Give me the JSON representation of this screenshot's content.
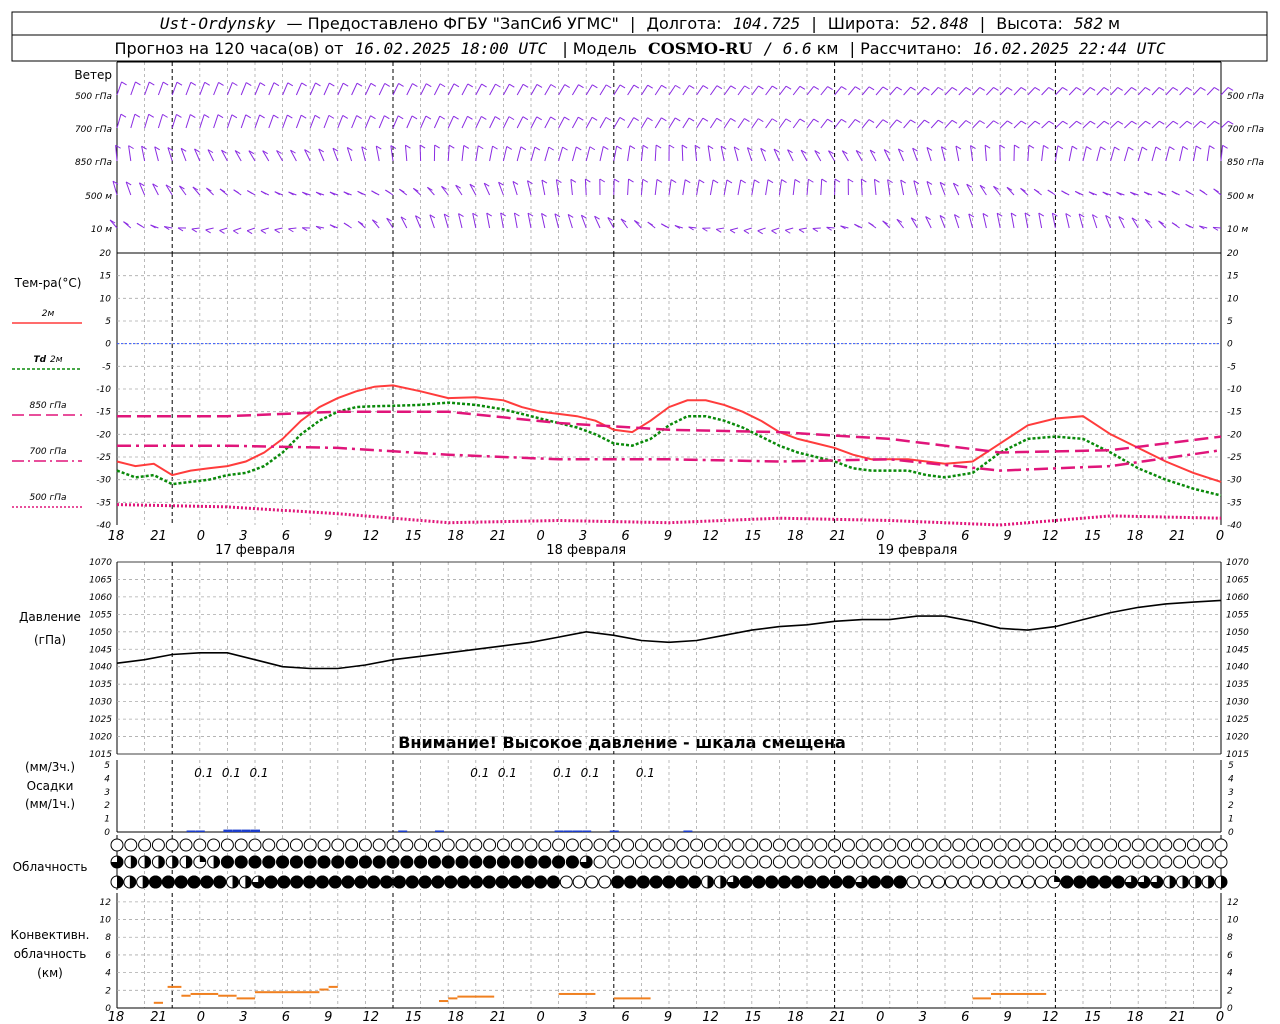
{
  "header": {
    "station": "Ust-Ordynsky",
    "provider": "— Предоставлено ФГБУ \"ЗапСиб УГМС\"",
    "lon_label": "Долгота:",
    "lon_value": "104.725",
    "lat_label": "Широта:",
    "lat_value": "52.848",
    "alt_label": "Высота:",
    "alt_value": "582",
    "alt_unit": "м",
    "forecast_prefix": "Прогноз на 120 часа(ов) от",
    "forecast_time": "16.02.2025 18:00 UTC",
    "model_label": "| Модель",
    "model_name": "COSMO-RU",
    "model_res": "/ 6.6",
    "model_unit": "км",
    "calc_label": "| Рассчитано:",
    "calc_time": "16.02.2025 22:44 UTC"
  },
  "labels": {
    "wind": "Ветер",
    "wind_levels": [
      "500 гПа",
      "700 гПа",
      "850 гПа",
      "500 м",
      "10 м"
    ],
    "temp_title": "Тем-ра(°C)",
    "t2m": "2м",
    "td2m_a": "Td",
    "td2m_b": "2м",
    "t850": "850 гПа",
    "t700": "700 гПа",
    "t500": "500 гПа",
    "pressure_a": "Давление",
    "pressure_b": "(гПа)",
    "warning": "Внимание! Высокое давление - шкала смещена",
    "precip_a": "(мм/3ч.)",
    "precip_b": "Осадки",
    "precip_c": "(мм/1ч.)",
    "cloud": "Облачность",
    "conv_a": "Конвективн.",
    "conv_b": "облачность",
    "conv_c": "(км)"
  },
  "colors": {
    "wind": "#8a2be2",
    "t2m": "#ff3c3c",
    "td2m": "#0a8a0a",
    "levels": "#e0157a",
    "zero_line": "#3355ff",
    "pressure": "#000000",
    "precip": "#1a3ccc",
    "conv": "#f08020"
  },
  "x_axis": {
    "hour_labels": [
      "18",
      "21",
      "0",
      "3",
      "6",
      "9",
      "12",
      "15",
      "18",
      "21",
      "0",
      "3",
      "6",
      "9",
      "12",
      "15",
      "18",
      "21",
      "0",
      "3",
      "6",
      "9",
      "12",
      "15",
      "18",
      "21",
      "0"
    ],
    "dates": [
      "17 февраля",
      "18 февраля",
      "19 февраля"
    ]
  },
  "chart_data": [
    {
      "type": "line",
      "title": "Тем-ра(°C)",
      "x_unit": "hours from 16.02.2025 18:00 UTC",
      "ylim": [
        -40,
        20
      ],
      "yticks": [
        20,
        15,
        10,
        5,
        0,
        -5,
        -10,
        -15,
        -20,
        -25,
        -30,
        -35,
        -40
      ],
      "grid": true,
      "series": [
        {
          "name": "2м",
          "x": [
            0,
            2,
            4,
            6,
            8,
            10,
            12,
            14,
            16,
            18,
            20,
            22,
            24,
            26,
            28,
            30,
            33,
            36,
            39,
            42,
            44,
            46,
            48,
            50,
            52,
            54,
            56,
            58,
            60,
            62,
            64,
            66,
            68,
            70,
            72,
            74,
            76,
            78,
            80,
            82,
            84,
            86,
            88,
            90,
            93,
            96,
            99,
            102,
            105,
            108,
            111,
            114,
            117,
            120
          ],
          "y": [
            -26,
            -27,
            -26.5,
            -29,
            -28,
            -27.5,
            -27,
            -26,
            -24,
            -21,
            -17,
            -14,
            -12,
            -10.5,
            -9.5,
            -9.2,
            -10.5,
            -12,
            -11.8,
            -12.5,
            -14,
            -15,
            -15.5,
            -16,
            -17,
            -19,
            -19.5,
            -17,
            -14,
            -12.5,
            -12.5,
            -13.5,
            -15,
            -17,
            -19.5,
            -21,
            -22,
            -23,
            -24.5,
            -25.5,
            -25.5,
            -25.5,
            -26,
            -26.5,
            -26,
            -22,
            -18,
            -16.5,
            -16,
            -20,
            -23,
            -26,
            -28.5,
            -30.5
          ]
        },
        {
          "name": "Td 2м",
          "x": [
            0,
            2,
            4,
            6,
            8,
            10,
            12,
            14,
            16,
            18,
            20,
            22,
            24,
            26,
            28,
            30,
            33,
            36,
            39,
            42,
            44,
            46,
            48,
            50,
            52,
            54,
            56,
            58,
            60,
            62,
            64,
            66,
            68,
            70,
            72,
            74,
            76,
            78,
            80,
            82,
            84,
            86,
            88,
            90,
            93,
            96,
            99,
            102,
            105,
            108,
            111,
            114,
            117,
            120
          ],
          "y": [
            -28,
            -29.5,
            -29,
            -31,
            -30.5,
            -30,
            -29,
            -28.5,
            -27,
            -24,
            -20,
            -17,
            -15,
            -14,
            -13.8,
            -13.7,
            -13.5,
            -13,
            -13.5,
            -14.5,
            -15.5,
            -16.5,
            -17.5,
            -18.5,
            -20,
            -22,
            -22.5,
            -21,
            -18,
            -16,
            -16,
            -17,
            -18.5,
            -20.5,
            -22.5,
            -24,
            -25,
            -26,
            -27.5,
            -28,
            -28,
            -28,
            -29,
            -29.5,
            -28.5,
            -24,
            -21,
            -20.5,
            -21,
            -24,
            -27.5,
            -30,
            -32,
            -33.5
          ]
        },
        {
          "name": "850 гПа",
          "x": [
            0,
            12,
            24,
            36,
            48,
            60,
            72,
            84,
            96,
            108,
            120
          ],
          "y": [
            -16,
            -16,
            -15,
            -15,
            -17.5,
            -19,
            -19.5,
            -21,
            -24,
            -23.5,
            -20.5
          ]
        },
        {
          "name": "700 гПа",
          "x": [
            0,
            12,
            24,
            36,
            48,
            60,
            72,
            84,
            96,
            108,
            120
          ],
          "y": [
            -22.5,
            -22.5,
            -23,
            -24.5,
            -25.5,
            -25.5,
            -26,
            -25.5,
            -28,
            -27,
            -23.5
          ]
        },
        {
          "name": "500 гПа",
          "x": [
            0,
            12,
            24,
            36,
            48,
            60,
            72,
            84,
            96,
            108,
            120
          ],
          "y": [
            -35.5,
            -36,
            -37.5,
            -39.5,
            -39,
            -39.5,
            -38.5,
            -39,
            -40,
            -38,
            -38.5
          ]
        }
      ]
    },
    {
      "type": "line",
      "title": "Давление (гПа)",
      "ylim": [
        1015,
        1070
      ],
      "yticks": [
        1070,
        1065,
        1060,
        1055,
        1050,
        1045,
        1040,
        1035,
        1030,
        1025,
        1020,
        1015
      ],
      "grid": true,
      "series": [
        {
          "name": "pressure",
          "x": [
            0,
            3,
            6,
            9,
            12,
            15,
            18,
            21,
            24,
            27,
            30,
            33,
            36,
            39,
            42,
            45,
            48,
            51,
            54,
            57,
            60,
            63,
            66,
            69,
            72,
            75,
            78,
            81,
            84,
            87,
            90,
            93,
            96,
            99,
            102,
            105,
            108,
            111,
            114,
            117,
            120
          ],
          "y": [
            1041,
            1042,
            1043.5,
            1044,
            1044,
            1042,
            1040,
            1039.5,
            1039.5,
            1040.5,
            1042,
            1043,
            1044,
            1045,
            1046,
            1047,
            1048.5,
            1050,
            1049,
            1047.5,
            1047,
            1047.5,
            1049,
            1050.5,
            1051.5,
            1052,
            1053,
            1053.5,
            1053.5,
            1054.5,
            1054.5,
            1053,
            1051,
            1050.5,
            1051.5,
            1053.5,
            1055.5,
            1057,
            1058,
            1058.5,
            1059
          ]
        }
      ]
    },
    {
      "type": "bar",
      "title": "Осадки",
      "ylim": [
        0,
        5
      ],
      "yticks": [
        5,
        4,
        3,
        2,
        1,
        0
      ],
      "series": [
        {
          "name": "мм/3ч.",
          "x": [
            9,
            12,
            15,
            39,
            42,
            48,
            51,
            57
          ],
          "values": [
            0.1,
            0.1,
            0.1,
            0.1,
            0.1,
            0.1,
            0.1,
            0.1
          ]
        },
        {
          "name": "мм/1ч.",
          "x": [
            8,
            9,
            12,
            13,
            14,
            15,
            31,
            35,
            48,
            49,
            50,
            51,
            54,
            62
          ],
          "values": [
            0.1,
            0.1,
            0.2,
            0.2,
            0.2,
            0.2,
            0.1,
            0.1,
            0.1,
            0.1,
            0.1,
            0.1,
            0.1,
            0.1
          ]
        }
      ]
    },
    {
      "type": "heatmap",
      "title": "Облачность",
      "x_step_hours": 1.5,
      "rows": [
        {
          "name": "upper",
          "values": [
            0,
            0,
            0,
            0,
            0,
            0,
            0,
            0,
            0,
            0,
            0,
            0,
            0,
            0,
            0,
            0,
            0,
            0,
            0,
            0,
            0,
            0,
            0,
            0,
            0,
            0,
            0,
            0,
            0,
            0,
            0,
            0,
            0,
            0,
            0,
            0,
            0,
            0,
            0,
            0,
            0,
            0,
            0,
            0,
            0,
            0,
            0,
            0,
            0,
            0,
            0,
            0,
            0,
            0,
            0,
            0,
            0,
            0,
            0,
            0,
            0,
            0,
            0,
            0,
            0,
            0,
            0,
            0,
            0,
            0,
            0,
            0,
            0,
            0,
            0,
            0,
            0,
            0,
            0,
            0,
            0
          ]
        },
        {
          "name": "middle",
          "values": [
            0.75,
            0.5,
            0.5,
            0.5,
            0.5,
            0.5,
            0.25,
            0.5,
            1,
            1,
            1,
            1,
            1,
            1,
            1,
            1,
            1,
            1,
            1,
            1,
            1,
            1,
            1,
            1,
            1,
            1,
            1,
            1,
            1,
            1,
            1,
            1,
            1,
            1,
            0.75,
            0,
            0,
            0,
            0,
            0,
            0,
            0,
            0,
            0,
            0,
            0,
            0,
            0,
            0,
            0,
            0,
            0,
            0,
            0,
            0,
            0,
            0,
            0,
            0,
            0,
            0,
            0,
            0,
            0,
            0,
            0,
            0,
            0,
            0,
            0,
            0,
            0,
            0,
            0,
            0,
            0,
            0,
            0,
            0,
            0,
            0
          ]
        },
        {
          "name": "lower",
          "values": [
            0.5,
            0.5,
            0.5,
            1,
            1,
            1,
            1,
            1,
            1,
            0.5,
            0.5,
            0.75,
            1,
            1,
            1,
            1,
            1,
            1,
            1,
            1,
            1,
            1,
            1,
            1,
            1,
            1,
            1,
            1,
            1,
            1,
            1,
            1,
            1,
            1,
            1,
            0,
            0,
            0,
            0,
            1,
            1,
            1,
            1,
            1,
            1,
            1,
            0.5,
            0.5,
            0.75,
            1,
            1,
            1,
            1,
            1,
            1,
            1,
            1,
            1,
            0.75,
            1,
            1,
            1,
            0,
            0,
            0,
            0,
            0,
            0,
            0,
            0,
            0,
            0,
            0,
            0.25,
            1,
            1,
            1,
            1,
            1,
            0.75,
            0.75,
            0.75,
            0.5,
            0.5,
            0.5,
            0.5,
            0.5
          ]
        }
      ]
    },
    {
      "type": "bar",
      "title": "Конвективн. облачность (км)",
      "ylim": [
        0,
        13
      ],
      "yticks": [
        12,
        10,
        8,
        6,
        4,
        2,
        0
      ],
      "segments": [
        {
          "x0": 4,
          "x1": 5,
          "base": 0.5,
          "top": 0.7
        },
        {
          "x0": 5.5,
          "x1": 7,
          "base": 2.3,
          "top": 2.5
        },
        {
          "x0": 7,
          "x1": 8,
          "base": 1.3,
          "top": 1.5
        },
        {
          "x0": 8,
          "x1": 11,
          "base": 1.5,
          "top": 1.7
        },
        {
          "x0": 11,
          "x1": 13,
          "base": 1.3,
          "top": 1.5
        },
        {
          "x0": 13,
          "x1": 15,
          "base": 1.0,
          "top": 1.2
        },
        {
          "x0": 15,
          "x1": 22,
          "base": 1.7,
          "top": 1.9
        },
        {
          "x0": 22,
          "x1": 23,
          "base": 2.0,
          "top": 2.2
        },
        {
          "x0": 23,
          "x1": 24,
          "base": 2.3,
          "top": 2.5
        },
        {
          "x0": 35,
          "x1": 36,
          "base": 0.7,
          "top": 0.9
        },
        {
          "x0": 36,
          "x1": 37,
          "base": 1.0,
          "top": 1.2
        },
        {
          "x0": 37,
          "x1": 41,
          "base": 1.2,
          "top": 1.4
        },
        {
          "x0": 48,
          "x1": 52,
          "base": 1.5,
          "top": 1.7
        },
        {
          "x0": 54,
          "x1": 58,
          "base": 1.0,
          "top": 1.2
        },
        {
          "x0": 93,
          "x1": 95,
          "base": 1.0,
          "top": 1.2
        },
        {
          "x0": 95,
          "x1": 101,
          "base": 1.5,
          "top": 1.7
        }
      ]
    }
  ],
  "precip_labels": [
    "0.1",
    "0.1",
    "0.1",
    "0.1",
    "0.1",
    "0.1",
    "0.1",
    "0.1"
  ]
}
